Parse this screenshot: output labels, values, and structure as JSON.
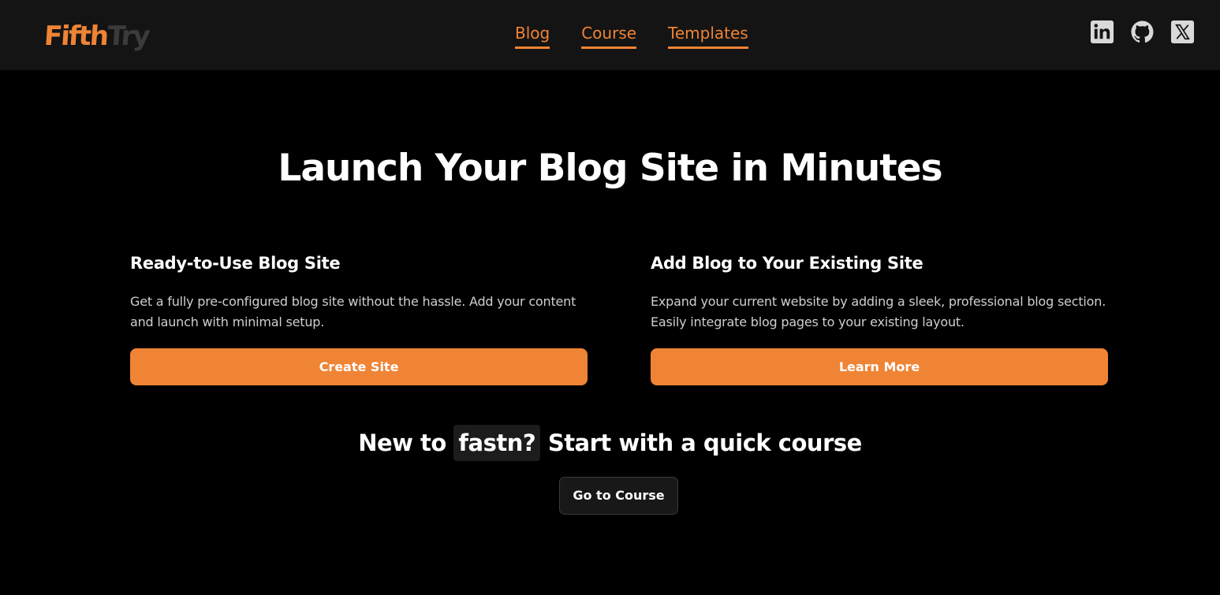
{
  "header": {
    "logo": {
      "part1": "Fifth",
      "part2": "Try"
    },
    "nav": [
      {
        "label": "Blog"
      },
      {
        "label": "Course"
      },
      {
        "label": "Templates"
      }
    ],
    "social_icons": [
      "linkedin-icon",
      "github-icon",
      "x-twitter-icon"
    ]
  },
  "hero": {
    "title": "Launch Your Blog Site in Minutes"
  },
  "cards": [
    {
      "title": "Ready-to-Use Blog Site",
      "description": "Get a fully pre-configured blog site without the hassle. Add your content and launch with minimal setup.",
      "button": "Create Site"
    },
    {
      "title": "Add Blog to Your Existing Site",
      "description": "Expand your current website by adding a sleek, professional blog section. Easily integrate blog pages to your existing layout.",
      "button": "Learn More"
    }
  ],
  "course": {
    "prefix": "New to",
    "code": "fastn?",
    "suffix": "Start with a quick course",
    "button": "Go to Course"
  },
  "colors": {
    "accent": "#ef8435",
    "header_bg": "#141414",
    "page_bg": "#000000"
  }
}
